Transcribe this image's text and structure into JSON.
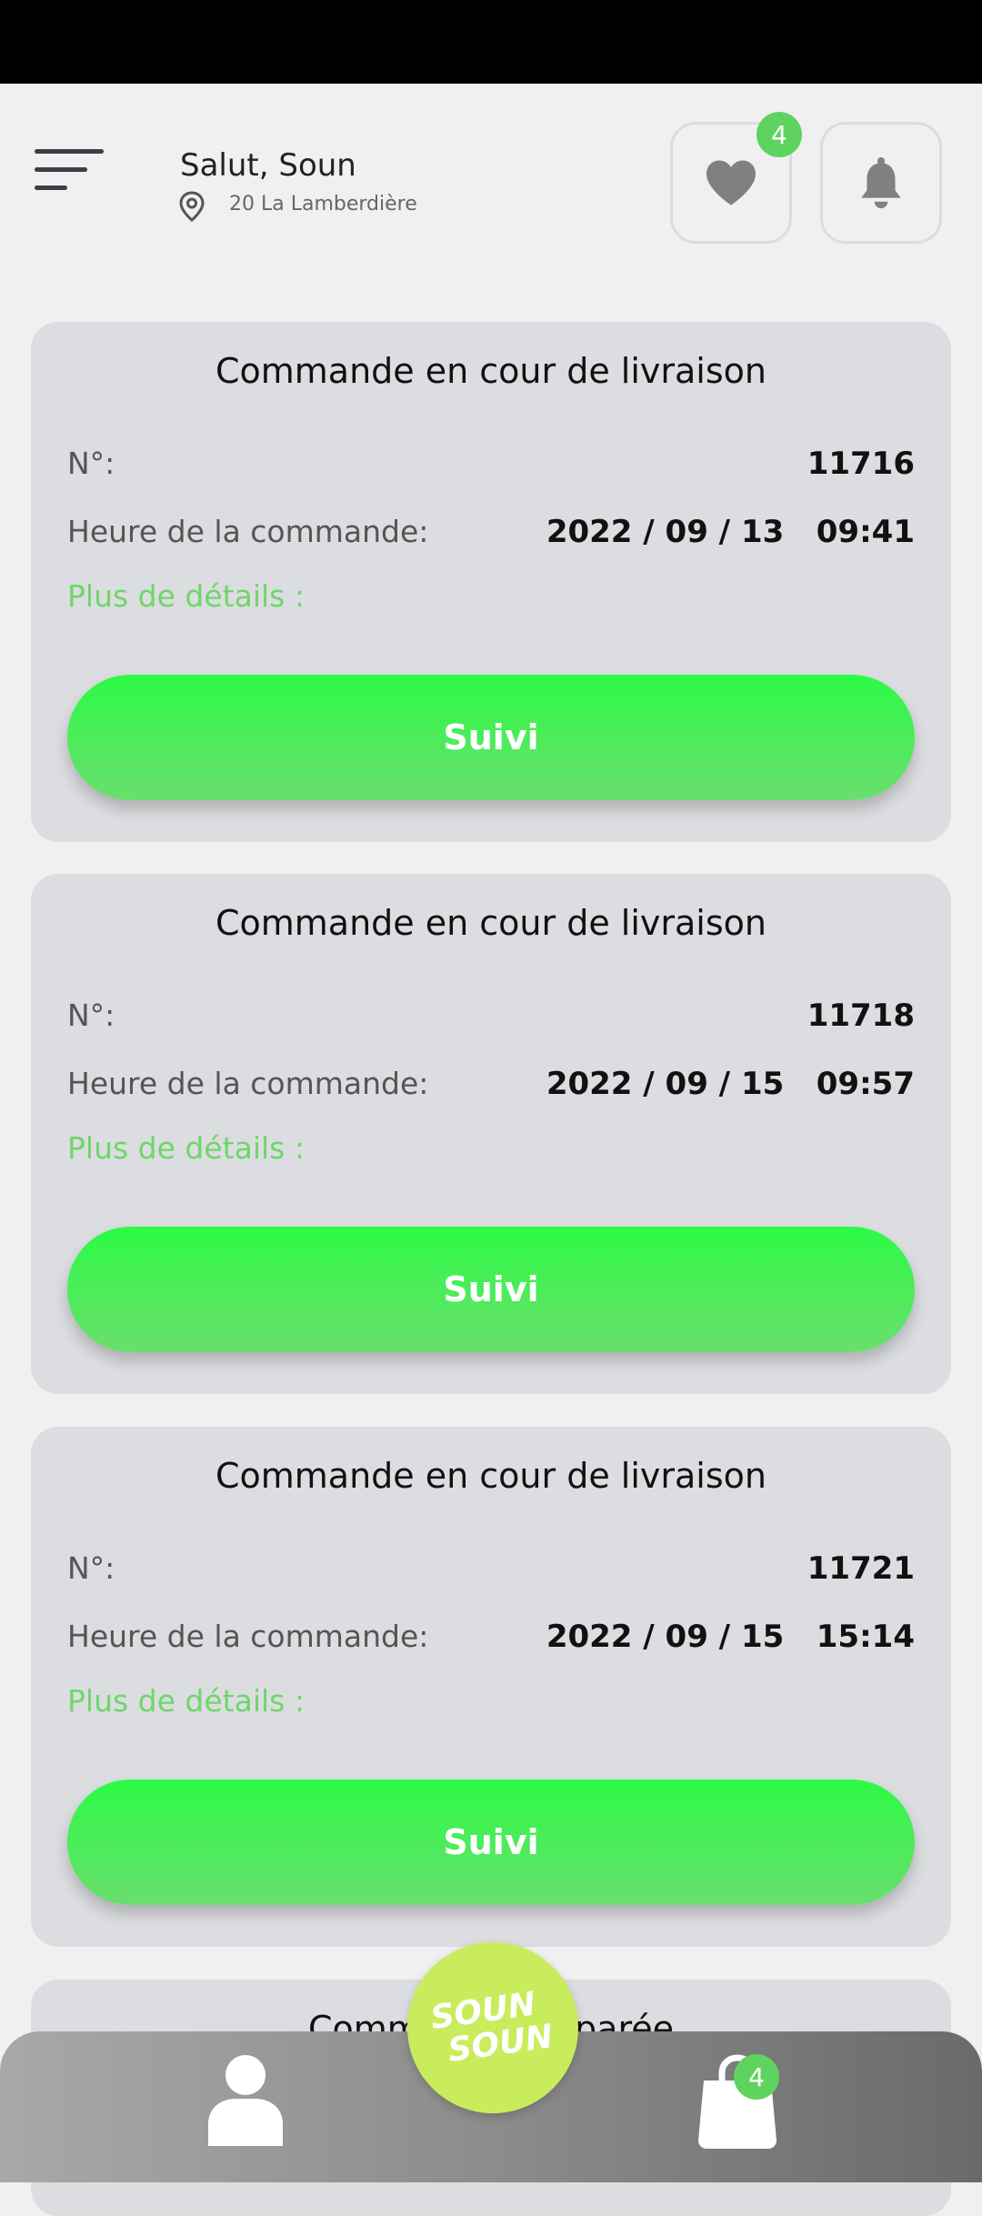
{
  "header": {
    "greeting": "Salut, Soun",
    "address": "20 La Lamberdière",
    "favorites_count": "4"
  },
  "orders": [
    {
      "title": "Commande en cour de livraison",
      "number_label": "N°:",
      "number": "11716",
      "time_label": "Heure de la commande:",
      "datetime": "2022 / 09 / 13   09:41",
      "details_link": "Plus de détails :",
      "button_label": "Suivi"
    },
    {
      "title": "Commande en cour de livraison",
      "number_label": "N°:",
      "number": "11718",
      "time_label": "Heure de la commande:",
      "datetime": "2022 / 09 / 15   09:57",
      "details_link": "Plus de détails :",
      "button_label": "Suivi"
    },
    {
      "title": "Commande en cour de livraison",
      "number_label": "N°:",
      "number": "11721",
      "time_label": "Heure de la commande:",
      "datetime": "2022 / 09 / 15   15:14",
      "details_link": "Plus de détails :",
      "button_label": "Suivi"
    }
  ],
  "partial_card": {
    "title": "Commande préparée"
  },
  "bottom_nav": {
    "cart_count": "4",
    "logo_text": [
      "SOUN",
      "SOUN"
    ]
  },
  "colors": {
    "accent_green": "#2cfb45",
    "link_green": "#6fd66b",
    "badge_green": "#5fd35f",
    "logo_lime": "#c9ec5c"
  }
}
